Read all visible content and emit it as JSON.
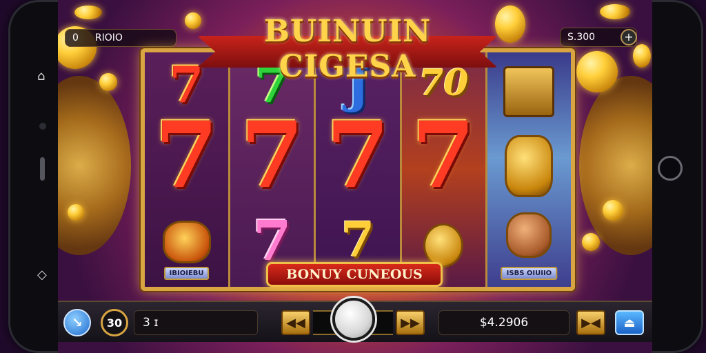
{
  "game": {
    "title": "BUINUIN CIGESA",
    "bonus_banner": "BONUY CUNEOUS"
  },
  "top_bar": {
    "left_counter_prefix": "0",
    "left_counter_value": "RIOIO",
    "right_counter_value": "S.300",
    "plus_icon": "+"
  },
  "reels": {
    "reel1": {
      "top_symbol": "7",
      "middle_symbol": "7",
      "label": "IBIOIEBU"
    },
    "reel2": {
      "top_symbol": "7",
      "middle_symbol": "7",
      "bottom_symbol": "7"
    },
    "reel3": {
      "top_symbol": "J",
      "middle_symbol": "7",
      "bottom_symbol": "7"
    },
    "reel4": {
      "top_symbol": "70",
      "middle_symbol": "7"
    },
    "reel5": {
      "label": "ISBS OIUIIO"
    }
  },
  "controls": {
    "bet_value": "30",
    "lines_value": "3 ɪ",
    "rewind_icon": "◀◀",
    "forward_icon": "▶▶",
    "balance": "$4.2906",
    "maxbet_icon": "▶◀",
    "info_icon": "⏏",
    "blue_icon": "↘"
  },
  "phone": {
    "rail_icons": [
      "⌂",
      "◇"
    ]
  },
  "colors": {
    "frame_gold": "#d9a542",
    "banner_red": "#d82a1a",
    "seven_red": "#ff3b23",
    "seven_green": "#2fd43a",
    "j_blue": "#2e6de0",
    "seven_pink": "#ff7bd0"
  }
}
